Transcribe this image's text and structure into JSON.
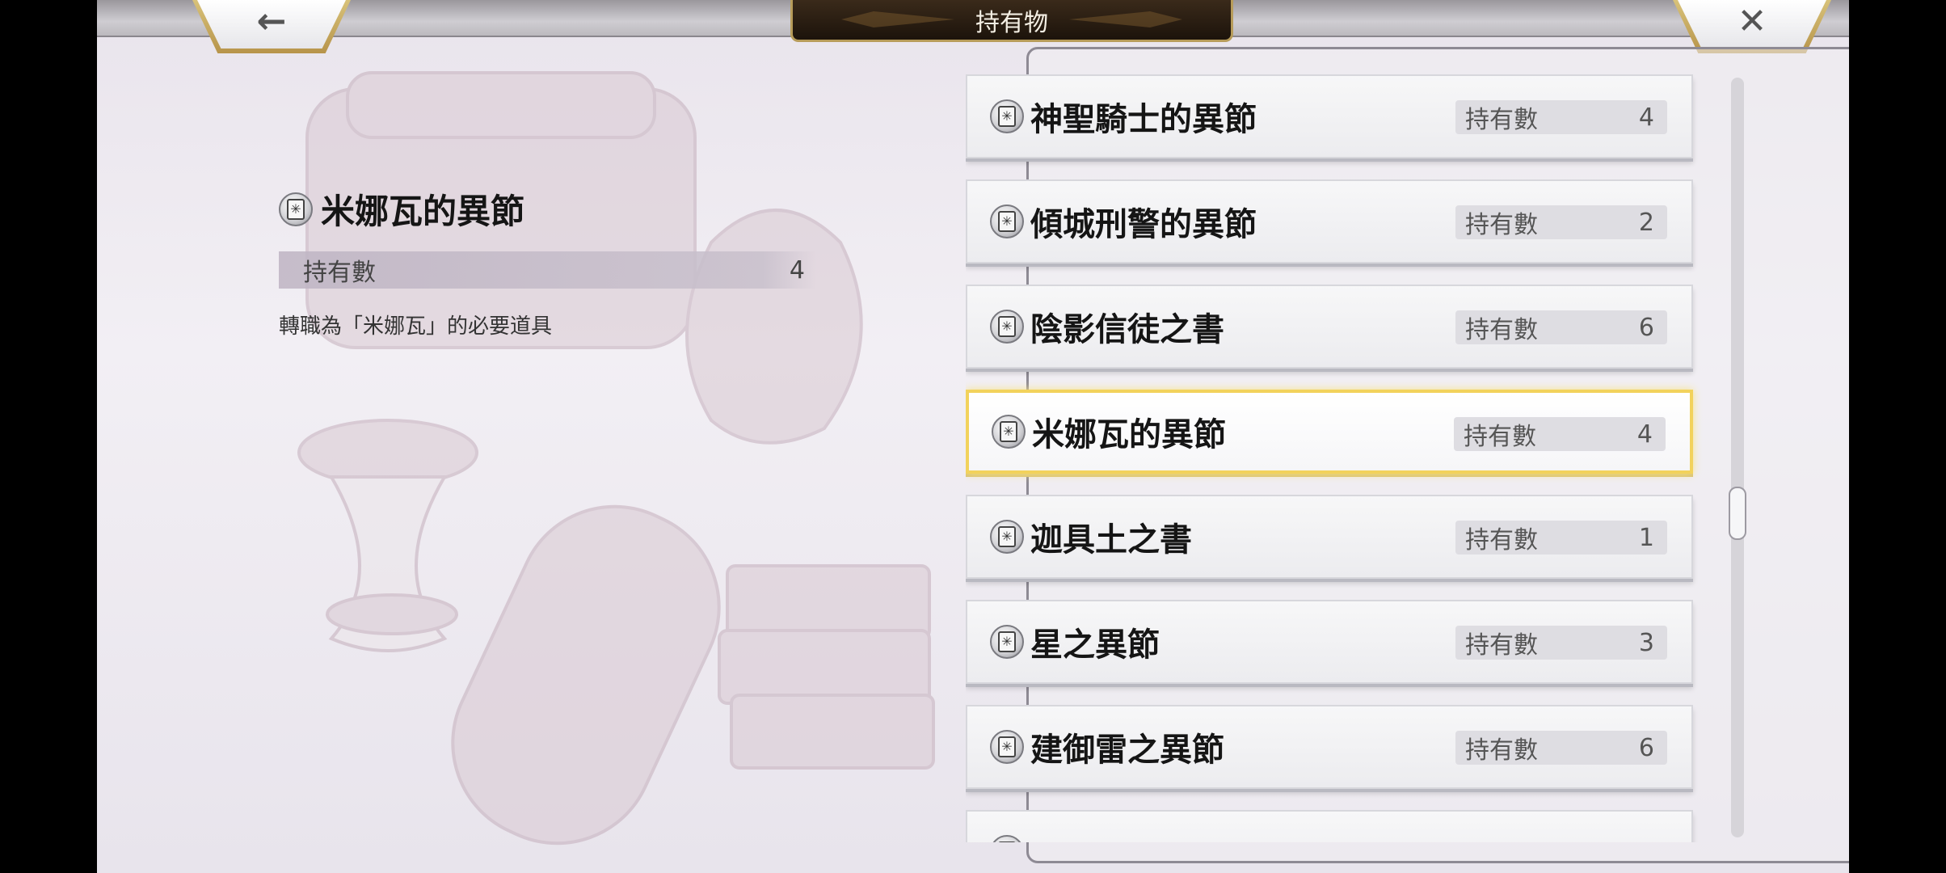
{
  "header": {
    "title": "持有物",
    "back_icon": "←",
    "close_icon": "✕"
  },
  "detail": {
    "item_name": "米娜瓦的異節",
    "count_label": "持有數",
    "count_value": "4",
    "description": "轉職為「米娜瓦」的必要道具"
  },
  "list": {
    "items": [
      {
        "name": "神聖騎士的異節",
        "count_label": "持有數",
        "count": "4"
      },
      {
        "name": "傾城刑警的異節",
        "count_label": "持有數",
        "count": "2"
      },
      {
        "name": "陰影信徒之書",
        "count_label": "持有數",
        "count": "6"
      },
      {
        "name": "米娜瓦的異節",
        "count_label": "持有數",
        "count": "4"
      },
      {
        "name": "迦具土之書",
        "count_label": "持有數",
        "count": "1"
      },
      {
        "name": "星之異節",
        "count_label": "持有數",
        "count": "3"
      },
      {
        "name": "建御雷之異節",
        "count_label": "持有數",
        "count": "6"
      }
    ],
    "selected_index": 3
  },
  "icons": {
    "item_icon": "book-icon",
    "item_icon_glyph": "✳"
  },
  "colors": {
    "selected_border": "#f2d25c",
    "title_plate": "#1c130b",
    "corner_trim": "#b7944a"
  }
}
